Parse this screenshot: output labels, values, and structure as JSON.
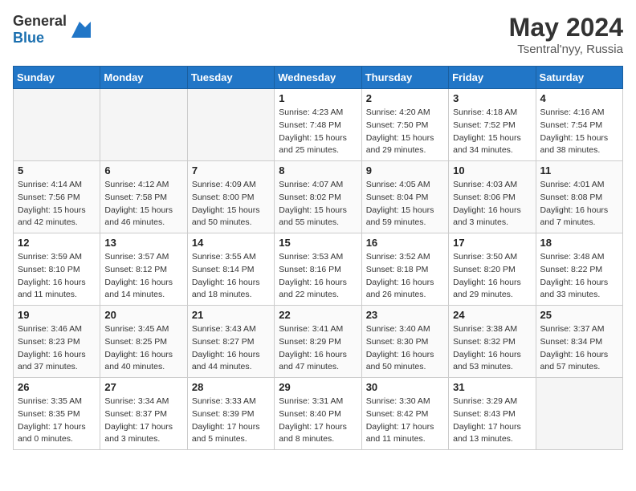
{
  "header": {
    "logo_general": "General",
    "logo_blue": "Blue",
    "title": "May 2024",
    "location": "Tsentral'nyy, Russia"
  },
  "weekdays": [
    "Sunday",
    "Monday",
    "Tuesday",
    "Wednesday",
    "Thursday",
    "Friday",
    "Saturday"
  ],
  "weeks": [
    [
      {
        "day": "",
        "info": ""
      },
      {
        "day": "",
        "info": ""
      },
      {
        "day": "",
        "info": ""
      },
      {
        "day": "1",
        "info": "Sunrise: 4:23 AM\nSunset: 7:48 PM\nDaylight: 15 hours\nand 25 minutes."
      },
      {
        "day": "2",
        "info": "Sunrise: 4:20 AM\nSunset: 7:50 PM\nDaylight: 15 hours\nand 29 minutes."
      },
      {
        "day": "3",
        "info": "Sunrise: 4:18 AM\nSunset: 7:52 PM\nDaylight: 15 hours\nand 34 minutes."
      },
      {
        "day": "4",
        "info": "Sunrise: 4:16 AM\nSunset: 7:54 PM\nDaylight: 15 hours\nand 38 minutes."
      }
    ],
    [
      {
        "day": "5",
        "info": "Sunrise: 4:14 AM\nSunset: 7:56 PM\nDaylight: 15 hours\nand 42 minutes."
      },
      {
        "day": "6",
        "info": "Sunrise: 4:12 AM\nSunset: 7:58 PM\nDaylight: 15 hours\nand 46 minutes."
      },
      {
        "day": "7",
        "info": "Sunrise: 4:09 AM\nSunset: 8:00 PM\nDaylight: 15 hours\nand 50 minutes."
      },
      {
        "day": "8",
        "info": "Sunrise: 4:07 AM\nSunset: 8:02 PM\nDaylight: 15 hours\nand 55 minutes."
      },
      {
        "day": "9",
        "info": "Sunrise: 4:05 AM\nSunset: 8:04 PM\nDaylight: 15 hours\nand 59 minutes."
      },
      {
        "day": "10",
        "info": "Sunrise: 4:03 AM\nSunset: 8:06 PM\nDaylight: 16 hours\nand 3 minutes."
      },
      {
        "day": "11",
        "info": "Sunrise: 4:01 AM\nSunset: 8:08 PM\nDaylight: 16 hours\nand 7 minutes."
      }
    ],
    [
      {
        "day": "12",
        "info": "Sunrise: 3:59 AM\nSunset: 8:10 PM\nDaylight: 16 hours\nand 11 minutes."
      },
      {
        "day": "13",
        "info": "Sunrise: 3:57 AM\nSunset: 8:12 PM\nDaylight: 16 hours\nand 14 minutes."
      },
      {
        "day": "14",
        "info": "Sunrise: 3:55 AM\nSunset: 8:14 PM\nDaylight: 16 hours\nand 18 minutes."
      },
      {
        "day": "15",
        "info": "Sunrise: 3:53 AM\nSunset: 8:16 PM\nDaylight: 16 hours\nand 22 minutes."
      },
      {
        "day": "16",
        "info": "Sunrise: 3:52 AM\nSunset: 8:18 PM\nDaylight: 16 hours\nand 26 minutes."
      },
      {
        "day": "17",
        "info": "Sunrise: 3:50 AM\nSunset: 8:20 PM\nDaylight: 16 hours\nand 29 minutes."
      },
      {
        "day": "18",
        "info": "Sunrise: 3:48 AM\nSunset: 8:22 PM\nDaylight: 16 hours\nand 33 minutes."
      }
    ],
    [
      {
        "day": "19",
        "info": "Sunrise: 3:46 AM\nSunset: 8:23 PM\nDaylight: 16 hours\nand 37 minutes."
      },
      {
        "day": "20",
        "info": "Sunrise: 3:45 AM\nSunset: 8:25 PM\nDaylight: 16 hours\nand 40 minutes."
      },
      {
        "day": "21",
        "info": "Sunrise: 3:43 AM\nSunset: 8:27 PM\nDaylight: 16 hours\nand 44 minutes."
      },
      {
        "day": "22",
        "info": "Sunrise: 3:41 AM\nSunset: 8:29 PM\nDaylight: 16 hours\nand 47 minutes."
      },
      {
        "day": "23",
        "info": "Sunrise: 3:40 AM\nSunset: 8:30 PM\nDaylight: 16 hours\nand 50 minutes."
      },
      {
        "day": "24",
        "info": "Sunrise: 3:38 AM\nSunset: 8:32 PM\nDaylight: 16 hours\nand 53 minutes."
      },
      {
        "day": "25",
        "info": "Sunrise: 3:37 AM\nSunset: 8:34 PM\nDaylight: 16 hours\nand 57 minutes."
      }
    ],
    [
      {
        "day": "26",
        "info": "Sunrise: 3:35 AM\nSunset: 8:35 PM\nDaylight: 17 hours\nand 0 minutes."
      },
      {
        "day": "27",
        "info": "Sunrise: 3:34 AM\nSunset: 8:37 PM\nDaylight: 17 hours\nand 3 minutes."
      },
      {
        "day": "28",
        "info": "Sunrise: 3:33 AM\nSunset: 8:39 PM\nDaylight: 17 hours\nand 5 minutes."
      },
      {
        "day": "29",
        "info": "Sunrise: 3:31 AM\nSunset: 8:40 PM\nDaylight: 17 hours\nand 8 minutes."
      },
      {
        "day": "30",
        "info": "Sunrise: 3:30 AM\nSunset: 8:42 PM\nDaylight: 17 hours\nand 11 minutes."
      },
      {
        "day": "31",
        "info": "Sunrise: 3:29 AM\nSunset: 8:43 PM\nDaylight: 17 hours\nand 13 minutes."
      },
      {
        "day": "",
        "info": ""
      }
    ]
  ]
}
